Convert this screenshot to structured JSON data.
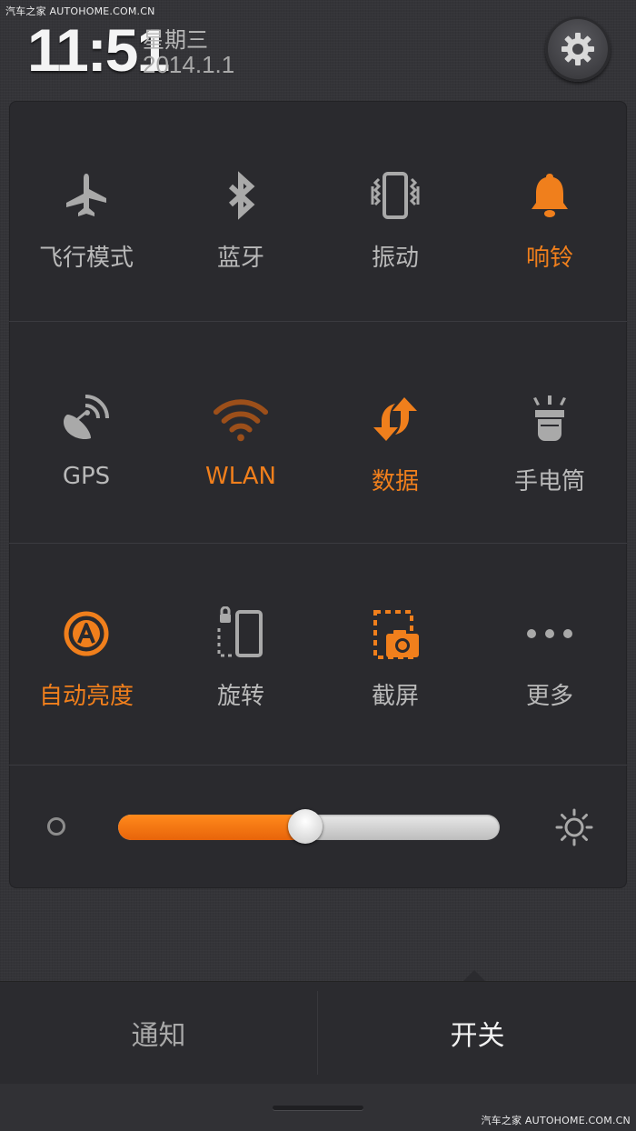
{
  "watermark": {
    "top": "汽车之家 AUTOHOME.COM.CN",
    "bottom": "汽车之家 AUTOHOME.COM.CN"
  },
  "status": {
    "time": "11:51",
    "weekday": "星期三",
    "date": "2014.1.1"
  },
  "colors": {
    "accent": "#f07f1c",
    "inactive": "#b9b9b9",
    "panel": "#2a2a2e"
  },
  "toggles": [
    [
      {
        "label": "飞行模式",
        "icon": "airplane-icon",
        "on": false
      },
      {
        "label": "蓝牙",
        "icon": "bluetooth-icon",
        "on": false
      },
      {
        "label": "振动",
        "icon": "vibrate-icon",
        "on": false
      },
      {
        "label": "响铃",
        "icon": "bell-icon",
        "on": true
      }
    ],
    [
      {
        "label": "GPS",
        "icon": "gps-icon",
        "on": false
      },
      {
        "label": "WLAN",
        "icon": "wifi-icon",
        "on": true
      },
      {
        "label": "数据",
        "icon": "data-icon",
        "on": true
      },
      {
        "label": "手电筒",
        "icon": "flashlight-icon",
        "on": false
      }
    ],
    [
      {
        "label": "自动亮度",
        "icon": "auto-brightness-icon",
        "on": true
      },
      {
        "label": "旋转",
        "icon": "rotate-icon",
        "on": false
      },
      {
        "label": "截屏",
        "icon": "screenshot-icon",
        "on": false
      },
      {
        "label": "更多",
        "icon": "more-icon",
        "on": false
      }
    ]
  ],
  "brightness": {
    "level": 0.49
  },
  "tabs": [
    {
      "label": "通知",
      "active": false
    },
    {
      "label": "开关",
      "active": true
    }
  ]
}
